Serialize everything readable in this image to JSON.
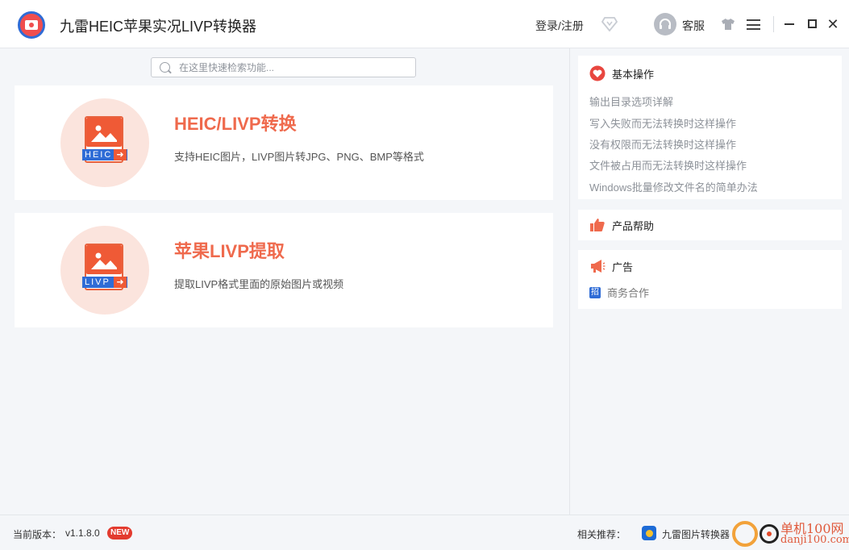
{
  "app": {
    "title": "九雷HEIC苹果实况LIVP转换器"
  },
  "titlebar": {
    "login_label": "登录/注册",
    "service_label": "客服",
    "icons": [
      "vip-diamond-icon",
      "headset-icon",
      "skin-icon",
      "menu-icon",
      "minimize-icon",
      "maximize-icon",
      "close-icon"
    ],
    "close_glyph": "✕"
  },
  "search": {
    "placeholder": "在这里快速检索功能..."
  },
  "cards": [
    {
      "title": "HEIC/LIVP转换",
      "desc": "支持HEIC图片，LIVP图片转JPG、PNG、BMP等格式",
      "icon_label": "HEIC",
      "icon": "heic-convert-icon"
    },
    {
      "title": "苹果LIVP提取",
      "desc": "提取LIVP格式里面的原始图片或视频",
      "icon_label": "LIVP",
      "icon": "livp-extract-icon"
    }
  ],
  "right_panel": {
    "basic": {
      "title": "基本操作",
      "links": [
        "输出目录选项详解",
        "写入失败而无法转换时这样操作",
        "没有权限而无法转换时这样操作",
        "文件被占用而无法转换时这样操作",
        "Windows批量修改文件名的简单办法"
      ]
    },
    "help": {
      "title": "产品帮助"
    },
    "ads": {
      "title": "广告",
      "biz_icon_glyph": "招",
      "biz_label": "商务合作"
    }
  },
  "statusbar": {
    "version_label": "当前版本：",
    "version_value": "v1.1.8.0",
    "new_badge": "NEW",
    "recommend_label": "相关推荐：",
    "recommend_link": "九雷图片转换器"
  },
  "watermark": {
    "line1": "单机100网",
    "line2": "danji100.com"
  },
  "colors": {
    "accent": "#ef6a4d",
    "brand_blue": "#2f6cd6",
    "heart": "#e8463f"
  }
}
